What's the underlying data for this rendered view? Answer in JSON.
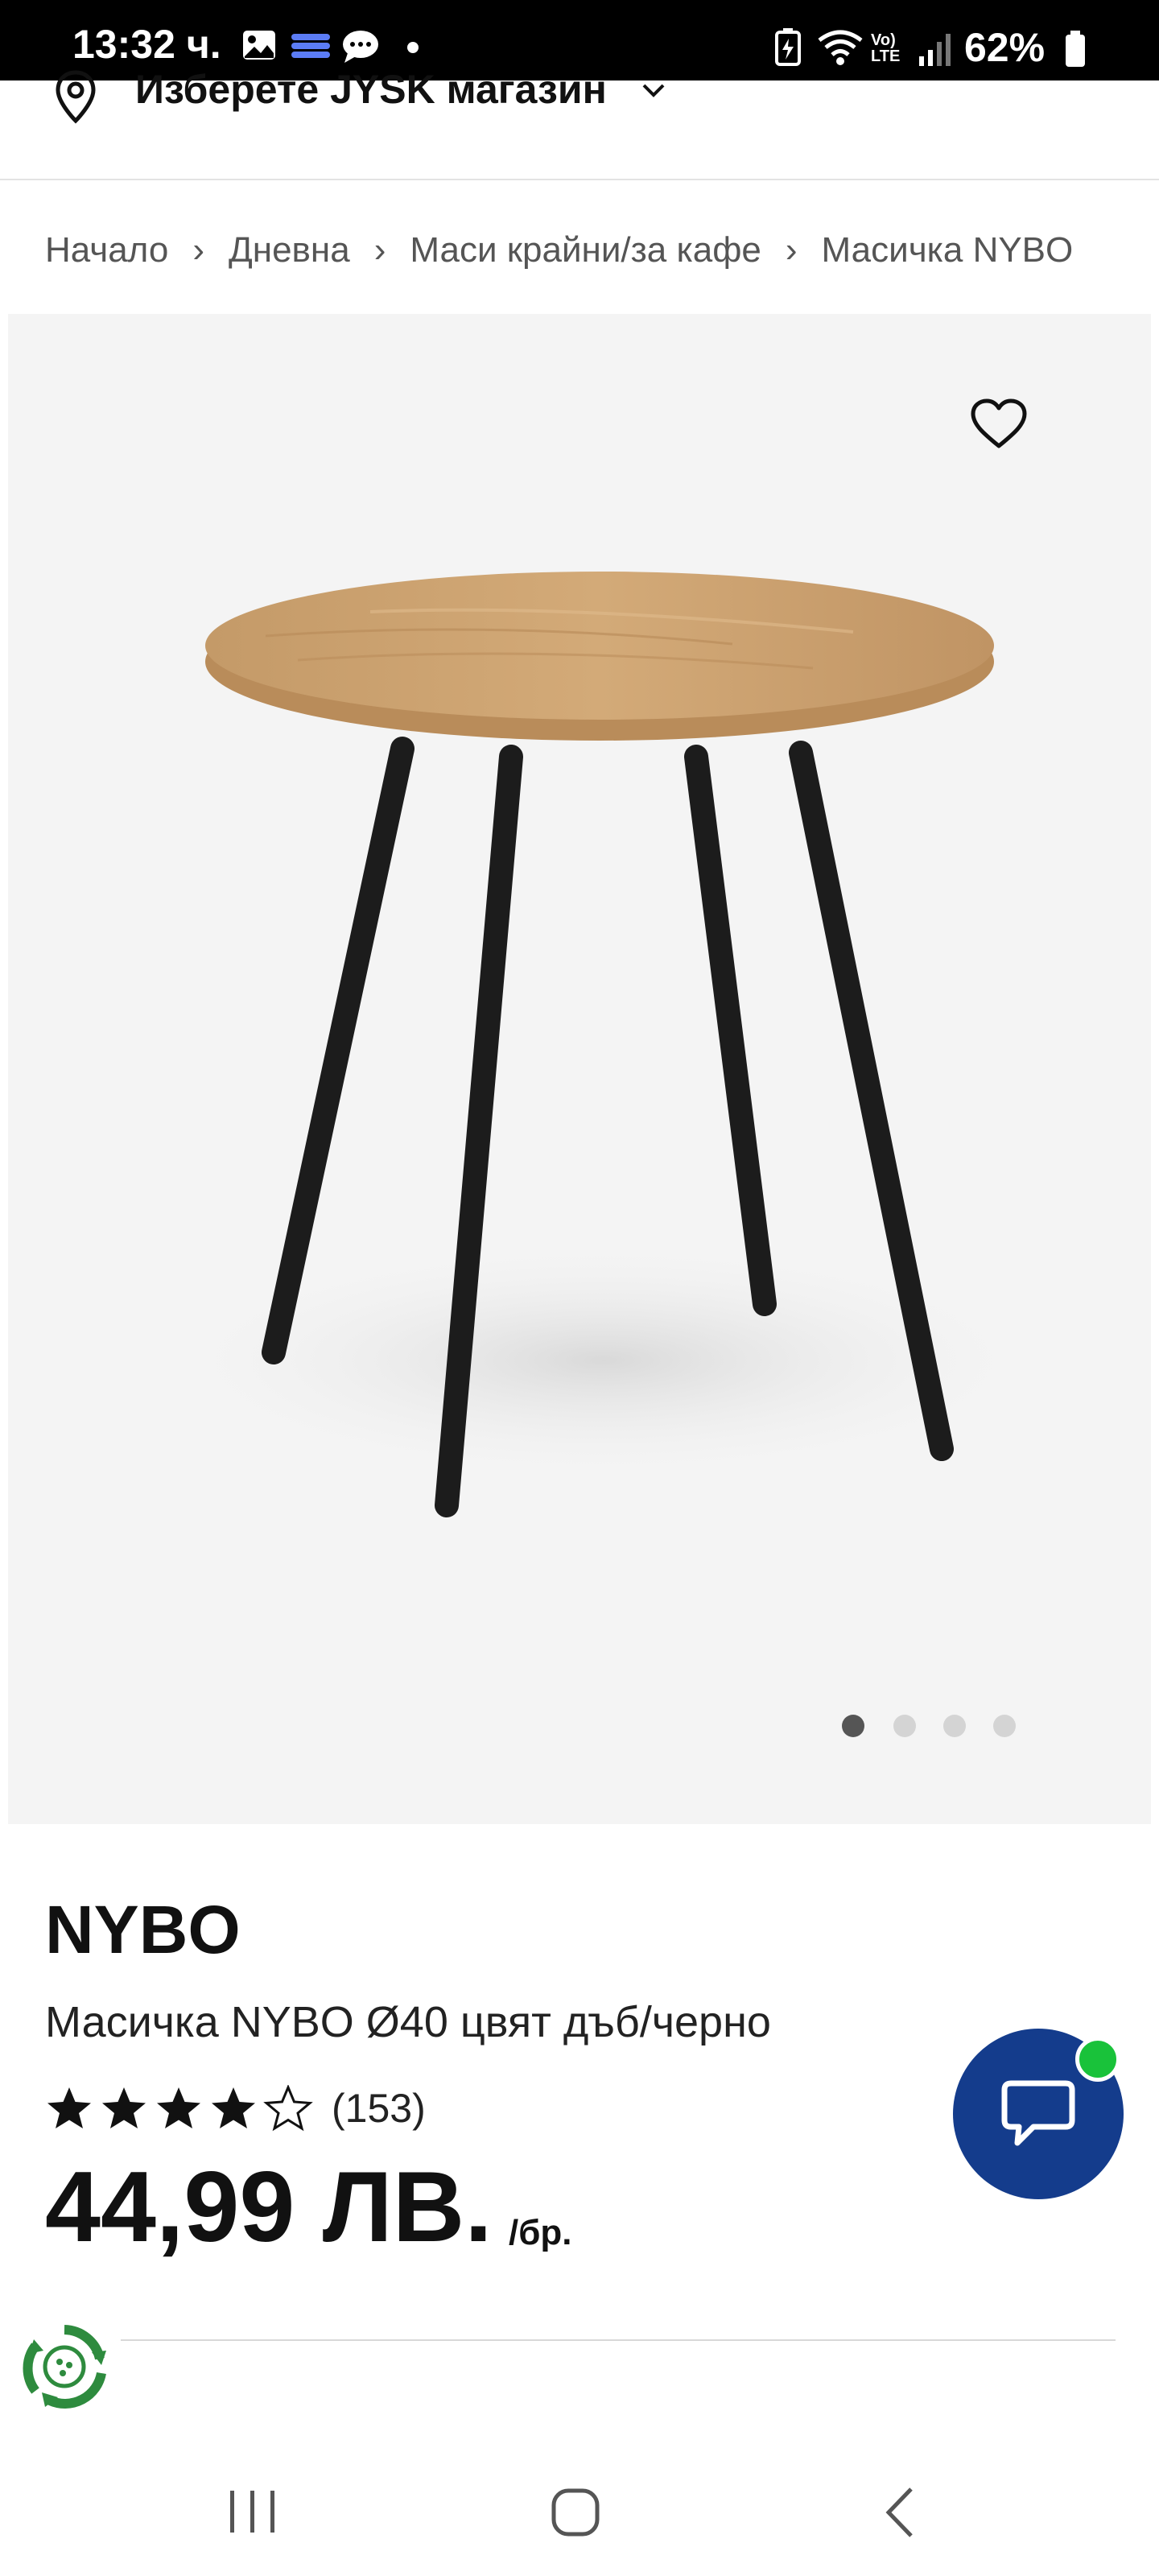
{
  "status_bar": {
    "time": "13:32 ч.",
    "network": "Vo) LTE",
    "battery": "62%"
  },
  "store": {
    "label": "Изберете JYSK магазин"
  },
  "breadcrumb": {
    "items": [
      "Начало",
      "Дневна",
      "Маси крайни/за кафе",
      "Масичка NYBO"
    ],
    "separator": "›"
  },
  "gallery": {
    "image_description_icon": "product-photo",
    "dots_total": 4,
    "dots_active": 1
  },
  "product": {
    "brand": "NYBO",
    "name": "Масичка NYBO Ø40 цвят дъб/черно",
    "rating_value": 4.5,
    "rating_max": 5,
    "rating_count": "(153)",
    "price": "44,99 ЛВ.",
    "price_unit": "/бр."
  },
  "chat": {
    "icon": "chat-bubble-icon",
    "status_color": "#19c23a",
    "bg_color": "#143c8c"
  },
  "nav": {
    "recents": "recents-icon",
    "home": "home-icon",
    "back": "back-icon"
  }
}
